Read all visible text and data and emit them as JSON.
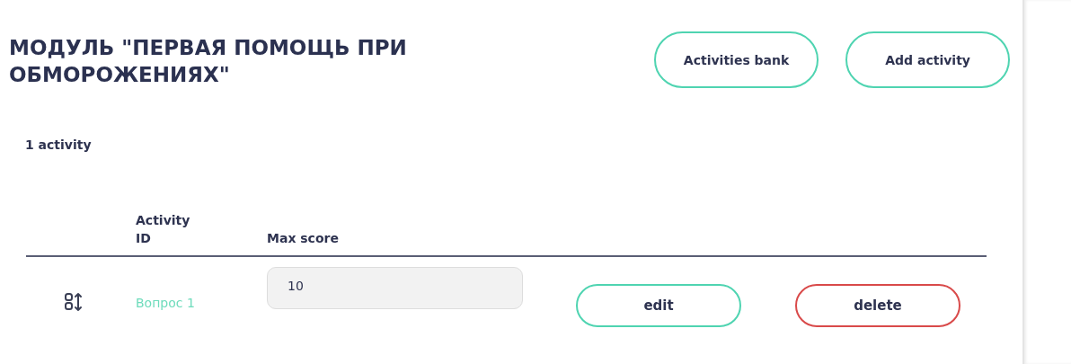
{
  "header": {
    "title": "МОДУЛЬ \"ПЕРВАЯ ПОМОЩЬ ПРИ ОБМОРОЖЕНИЯХ\"",
    "buttons": [
      "Activities bank",
      "Add activity"
    ]
  },
  "count": "1 activity",
  "table": {
    "columns": [
      "Activity ID",
      "Max score"
    ],
    "rows": [
      {
        "activity_id": "Вопрос 1",
        "max_score": "10",
        "actions": [
          {
            "label": "edit",
            "kind": "edit"
          },
          {
            "label": "delete",
            "kind": "delete"
          }
        ]
      }
    ]
  }
}
